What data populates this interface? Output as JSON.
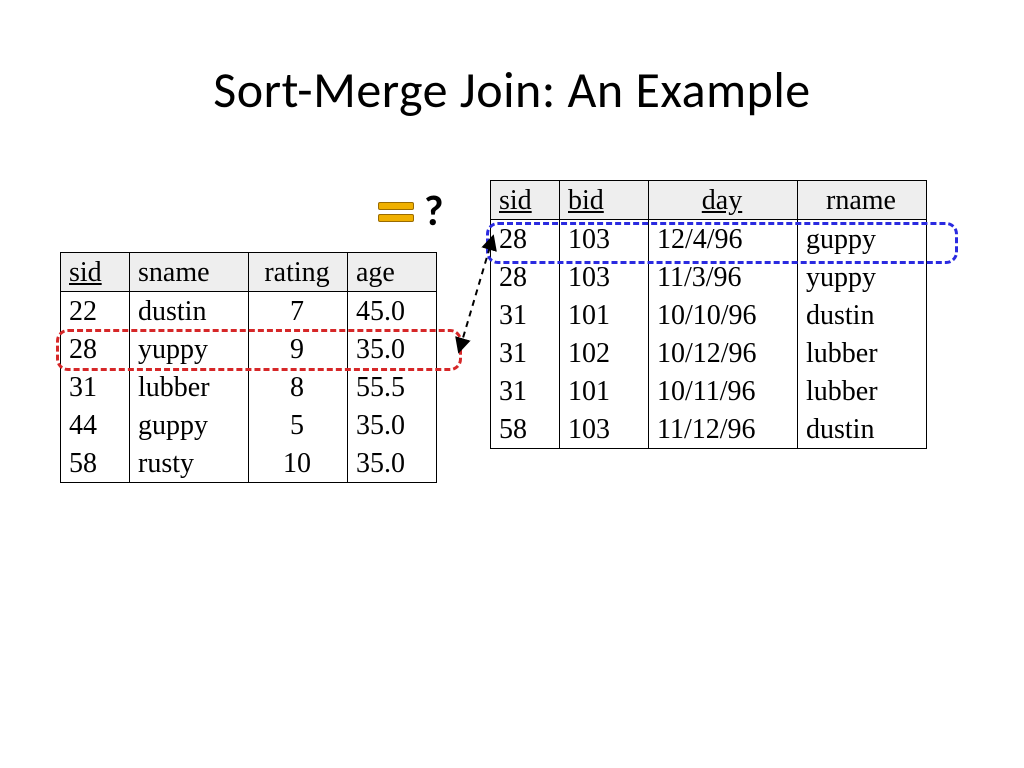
{
  "title": "Sort-Merge Join: An Example",
  "question_mark": "?",
  "sailors": {
    "headers": {
      "sid": "sid",
      "sname": "sname",
      "rating": "rating",
      "age": "age"
    },
    "rows": [
      {
        "sid": "22",
        "sname": "dustin",
        "rating": "7",
        "age": "45.0"
      },
      {
        "sid": "28",
        "sname": "yuppy",
        "rating": "9",
        "age": "35.0"
      },
      {
        "sid": "31",
        "sname": "lubber",
        "rating": "8",
        "age": "55.5"
      },
      {
        "sid": "44",
        "sname": "guppy",
        "rating": "5",
        "age": "35.0"
      },
      {
        "sid": "58",
        "sname": "rusty",
        "rating": "10",
        "age": "35.0"
      }
    ]
  },
  "reserves": {
    "headers": {
      "sid": "sid",
      "bid": "bid",
      "day": "day",
      "rname": "rname"
    },
    "rows": [
      {
        "sid": "28",
        "bid": "103",
        "day": "12/4/96",
        "rname": "guppy"
      },
      {
        "sid": "28",
        "bid": "103",
        "day": "11/3/96",
        "rname": "yuppy"
      },
      {
        "sid": "31",
        "bid": "101",
        "day": "10/10/96",
        "rname": "dustin"
      },
      {
        "sid": "31",
        "bid": "102",
        "day": "10/12/96",
        "rname": "lubber"
      },
      {
        "sid": "31",
        "bid": "101",
        "day": "10/11/96",
        "rname": "lubber"
      },
      {
        "sid": "58",
        "bid": "103",
        "day": "11/12/96",
        "rname": "dustin"
      }
    ]
  },
  "highlight": {
    "sailors_row_index": 1,
    "reserves_row_index": 0,
    "join_predicate": "sid = sid"
  },
  "colors": {
    "red": "#d62728",
    "blue": "#2a2ae0",
    "accent": "#f0b000"
  }
}
